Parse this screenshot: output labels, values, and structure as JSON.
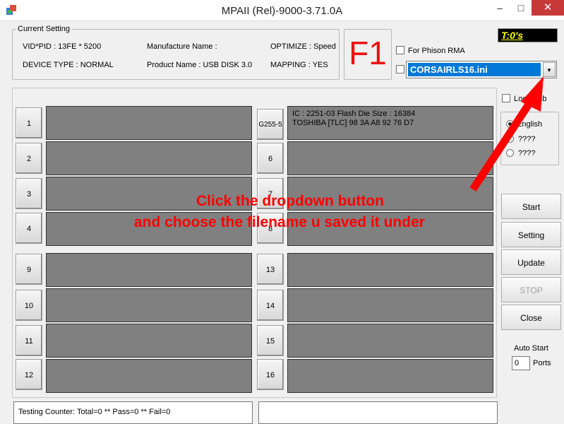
{
  "window": {
    "title": "MPAII (Rel)-9000-3.71.0A",
    "min": "–",
    "max": "□",
    "close": "✕"
  },
  "current_setting": {
    "label": "Current Setting",
    "vid_pid": "VID*PID : 13FE * 5200",
    "manufacture": "Manufacture Name :",
    "optimize": "OPTIMIZE : Speed",
    "device_type": "DEVICE TYPE : NORMAL",
    "product": "Product Name : USB DISK 3.0",
    "mapping": "MAPPING : YES"
  },
  "f1_label": "F1",
  "timer": "T:0's",
  "for_phison_rma": "For Phison RMA",
  "ini_select": {
    "value": "CORSAIRLS16.ini",
    "arrow": "▼"
  },
  "lock_hub": "Lock Hub",
  "language": {
    "english": "English",
    "opt2": "????",
    "opt3": "????"
  },
  "ports_left": [
    {
      "num": "1",
      "text": ""
    },
    {
      "num": "2",
      "text": ""
    },
    {
      "num": "3",
      "text": ""
    },
    {
      "num": "4",
      "text": ""
    },
    {
      "num": "9",
      "text": ""
    },
    {
      "num": "10",
      "text": ""
    },
    {
      "num": "11",
      "text": ""
    },
    {
      "num": "12",
      "text": ""
    }
  ],
  "ports_right": [
    {
      "num": "G255-5",
      "line1": "IC : 2251-03  Flash Die Size : 16384",
      "line2": "TOSHIBA [TLC] 98 3A A8 92 76 D7"
    },
    {
      "num": "6",
      "line1": "",
      "line2": ""
    },
    {
      "num": "7",
      "line1": "",
      "line2": ""
    },
    {
      "num": "8",
      "line1": "",
      "line2": ""
    },
    {
      "num": "13",
      "line1": "",
      "line2": ""
    },
    {
      "num": "14",
      "line1": "",
      "line2": ""
    },
    {
      "num": "15",
      "line1": "",
      "line2": ""
    },
    {
      "num": "16",
      "line1": "",
      "line2": ""
    }
  ],
  "buttons": {
    "start": "Start",
    "setting": "Setting",
    "update": "Update",
    "stop": "STOP",
    "close": "Close"
  },
  "auto_start": {
    "label": "Auto Start",
    "value": "0",
    "ports": "Ports"
  },
  "counter": "Testing Counter: Total=0 ** Pass=0 ** Fail=0",
  "annotation": {
    "line1": "Click the dropdown button",
    "line2": "and choose the filename u saved it under"
  },
  "colors": {
    "annotation": "#ff0000",
    "port_bg": "#808080",
    "select_bg": "#0078d7"
  }
}
